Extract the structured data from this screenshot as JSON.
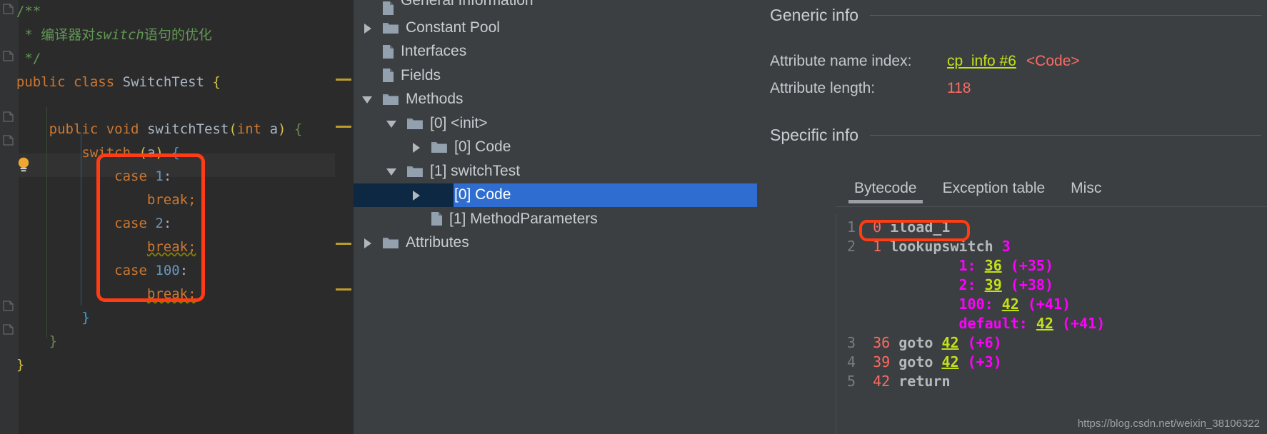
{
  "editor": {
    "language": "java",
    "lines": [
      {
        "indent": 0,
        "tokens": [
          {
            "t": "/**",
            "c": "cmt"
          }
        ]
      },
      {
        "indent": 0,
        "tokens": [
          {
            "t": " * ",
            "c": "cmt"
          },
          {
            "t": "编译器对",
            "c": "cmt"
          },
          {
            "t": "switch",
            "c": "cmt-i"
          },
          {
            "t": "语句的优化",
            "c": "cmt"
          }
        ]
      },
      {
        "indent": 0,
        "tokens": [
          {
            "t": " */",
            "c": "cmt"
          }
        ]
      },
      {
        "indent": 0,
        "tokens": [
          {
            "t": "public",
            "c": "kw"
          },
          {
            "t": " ",
            "c": "id"
          },
          {
            "t": "class",
            "c": "kw"
          },
          {
            "t": " ",
            "c": "id"
          },
          {
            "t": "SwitchTest",
            "c": "cls"
          },
          {
            "t": " ",
            "c": "id"
          },
          {
            "t": "{",
            "c": "brace-y"
          }
        ]
      },
      {
        "indent": 0,
        "tokens": []
      },
      {
        "indent": 1,
        "tokens": [
          {
            "t": "public",
            "c": "kw"
          },
          {
            "t": " ",
            "c": "id"
          },
          {
            "t": "void",
            "c": "kw"
          },
          {
            "t": " ",
            "c": "id"
          },
          {
            "t": "switchTest",
            "c": "cls"
          },
          {
            "t": "(",
            "c": "brace-y"
          },
          {
            "t": "int",
            "c": "kw"
          },
          {
            "t": " a",
            "c": "id"
          },
          {
            "t": ")",
            "c": "brace-y"
          },
          {
            "t": " ",
            "c": "id"
          },
          {
            "t": "{",
            "c": "brace-g"
          }
        ]
      },
      {
        "indent": 2,
        "tokens": [
          {
            "t": "switch",
            "c": "kw"
          },
          {
            "t": " ",
            "c": "id"
          },
          {
            "t": "(",
            "c": "brace-y"
          },
          {
            "t": "a",
            "c": "id"
          },
          {
            "t": ")",
            "c": "brace-y"
          },
          {
            "t": " ",
            "c": "id"
          },
          {
            "t": "{",
            "c": "brace-b"
          }
        ]
      },
      {
        "indent": 3,
        "tokens": [
          {
            "t": "case",
            "c": "kw"
          },
          {
            "t": " ",
            "c": "id"
          },
          {
            "t": "1",
            "c": "num"
          },
          {
            "t": ":",
            "c": "id"
          }
        ],
        "current": true
      },
      {
        "indent": 4,
        "tokens": [
          {
            "t": "break;",
            "c": "kw"
          }
        ]
      },
      {
        "indent": 3,
        "tokens": [
          {
            "t": "case",
            "c": "kw"
          },
          {
            "t": " ",
            "c": "id"
          },
          {
            "t": "2",
            "c": "num"
          },
          {
            "t": ":",
            "c": "id"
          }
        ]
      },
      {
        "indent": 4,
        "tokens": [
          {
            "t": "break;",
            "c": "kw-warn"
          }
        ]
      },
      {
        "indent": 3,
        "tokens": [
          {
            "t": "case",
            "c": "kw"
          },
          {
            "t": " ",
            "c": "id"
          },
          {
            "t": "100",
            "c": "num"
          },
          {
            "t": ":",
            "c": "id"
          }
        ]
      },
      {
        "indent": 4,
        "tokens": [
          {
            "t": "break;",
            "c": "kw-warn"
          }
        ]
      },
      {
        "indent": 2,
        "tokens": [
          {
            "t": "}",
            "c": "brace-b"
          }
        ]
      },
      {
        "indent": 1,
        "tokens": [
          {
            "t": "}",
            "c": "brace-g"
          }
        ]
      },
      {
        "indent": 0,
        "tokens": [
          {
            "t": "}",
            "c": "brace-y"
          }
        ]
      }
    ],
    "annotation": {
      "label": "switch-cases-highlight",
      "color": "#ff3c14"
    }
  },
  "tree": {
    "items": [
      {
        "label": "General Information",
        "expander": "none",
        "icon": "file-icon",
        "depth": 1,
        "partial": true
      },
      {
        "label": "Constant Pool",
        "expander": "closed",
        "icon": "folder-icon",
        "depth": 1
      },
      {
        "label": "Interfaces",
        "expander": "none",
        "icon": "file-icon",
        "depth": 1
      },
      {
        "label": "Fields",
        "expander": "none",
        "icon": "file-icon",
        "depth": 1
      },
      {
        "label": "Methods",
        "expander": "open",
        "icon": "folder-icon",
        "depth": 1
      },
      {
        "label": "[0] <init>",
        "expander": "open",
        "icon": "folder-icon",
        "depth": 2
      },
      {
        "label": "[0] Code",
        "expander": "closed",
        "icon": "folder-icon",
        "depth": 3
      },
      {
        "label": "[1] switchTest",
        "expander": "open",
        "icon": "folder-icon",
        "depth": 2
      },
      {
        "label": "[0] Code",
        "expander": "closed",
        "icon": "folder-icon",
        "depth": 3,
        "selected": true
      },
      {
        "label": "[1] MethodParameters",
        "expander": "none",
        "icon": "file-icon",
        "depth": 3
      },
      {
        "label": "Attributes",
        "expander": "closed",
        "icon": "folder-icon",
        "depth": 1
      }
    ],
    "selection_color": "#2f6dd0"
  },
  "detail": {
    "generic_info": {
      "title": "Generic info",
      "rows": [
        {
          "key": "Attribute name index:",
          "link": "cp_info #6",
          "extra": "<Code>"
        },
        {
          "key": "Attribute length:",
          "value": "118"
        }
      ]
    },
    "specific_info": {
      "title": "Specific info",
      "tabs": [
        {
          "label": "Bytecode",
          "active": true
        },
        {
          "label": "Exception table",
          "active": false
        },
        {
          "label": "Misc",
          "active": false
        }
      ]
    },
    "bytecode": {
      "lines": [
        {
          "ln": "1",
          "offset": "0",
          "mnemonic": "iload_1",
          "operands": []
        },
        {
          "ln": "2",
          "offset": "1",
          "mnemonic": "lookupswitch",
          "operands": [
            {
              "t": "3",
              "c": "op"
            }
          ],
          "annotated": true
        },
        {
          "ln": "",
          "offset": "",
          "mnemonic": "",
          "operands": [
            {
              "t": "1:",
              "c": "op"
            },
            {
              "t": "36",
              "c": "opl"
            },
            {
              "t": "(+35)",
              "c": "op"
            }
          ],
          "table": true
        },
        {
          "ln": "",
          "offset": "",
          "mnemonic": "",
          "operands": [
            {
              "t": "2:",
              "c": "op"
            },
            {
              "t": "39",
              "c": "opl"
            },
            {
              "t": "(+38)",
              "c": "op"
            }
          ],
          "table": true
        },
        {
          "ln": "",
          "offset": "",
          "mnemonic": "",
          "operands": [
            {
              "t": "100:",
              "c": "op"
            },
            {
              "t": "42",
              "c": "opl"
            },
            {
              "t": "(+41)",
              "c": "op"
            }
          ],
          "table": true
        },
        {
          "ln": "",
          "offset": "",
          "mnemonic": "",
          "operands": [
            {
              "t": "default:",
              "c": "op"
            },
            {
              "t": "42",
              "c": "opl"
            },
            {
              "t": "(+41)",
              "c": "op"
            }
          ],
          "table": true
        },
        {
          "ln": "3",
          "offset": "36",
          "mnemonic": "goto",
          "operands": [
            {
              "t": "42",
              "c": "opl"
            },
            {
              "t": "(+6)",
              "c": "op"
            }
          ]
        },
        {
          "ln": "4",
          "offset": "39",
          "mnemonic": "goto",
          "operands": [
            {
              "t": "42",
              "c": "opl"
            },
            {
              "t": "(+3)",
              "c": "op"
            }
          ]
        },
        {
          "ln": "5",
          "offset": "42",
          "mnemonic": "return",
          "operands": []
        }
      ],
      "annotation": {
        "label": "lookupswitch-highlight",
        "color": "#ff3c14"
      }
    }
  },
  "watermark": "https://blog.csdn.net/weixin_38106322"
}
